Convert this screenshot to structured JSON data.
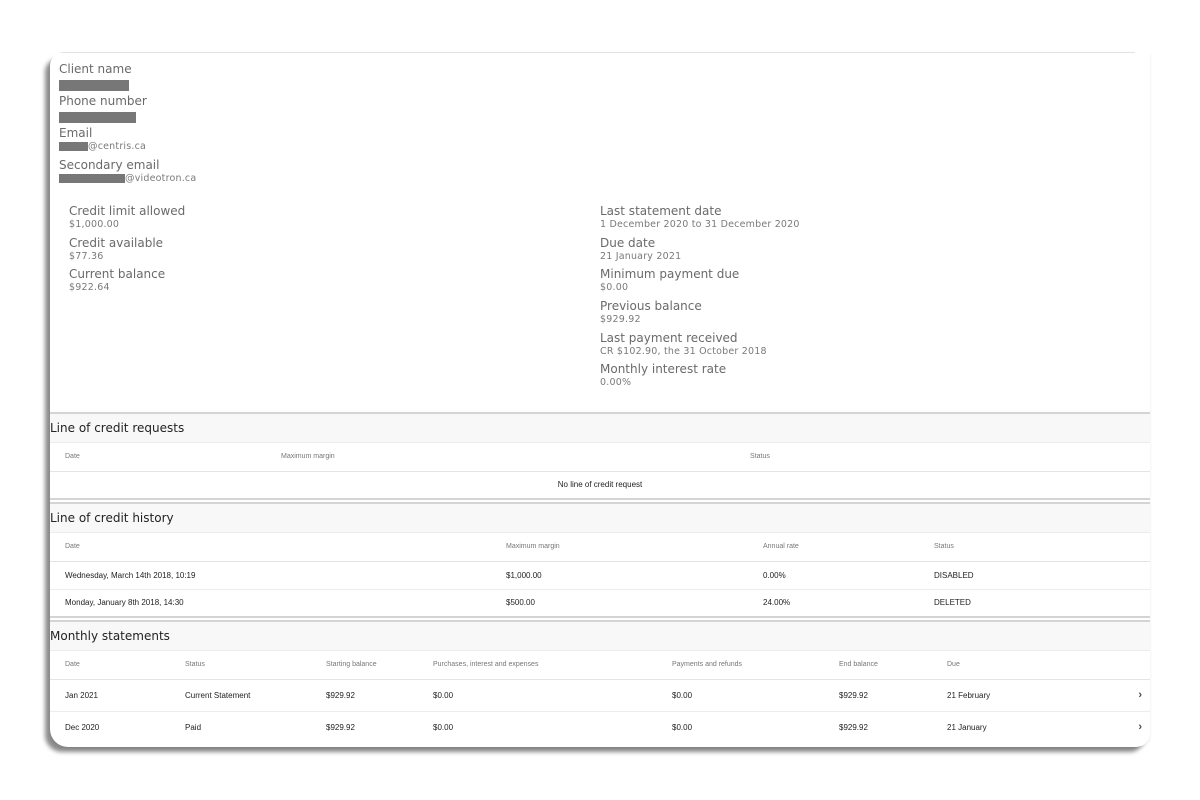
{
  "contact": {
    "client_name_label": "Client name",
    "phone_label": "Phone number",
    "email_label": "Email",
    "email_domain": "@centris.ca",
    "secondary_email_label": "Secondary email",
    "secondary_email_domain": "@videotron.ca"
  },
  "credit": {
    "left": [
      {
        "label": "Credit limit allowed",
        "value": "$1,000.00"
      },
      {
        "label": "Credit available",
        "value": "$77.36"
      },
      {
        "label": "Current balance",
        "value": "$922.64"
      }
    ],
    "right": [
      {
        "label": "Last statement date",
        "value": "1 December 2020 to 31 December 2020"
      },
      {
        "label": "Due date",
        "value": "21 January 2021"
      },
      {
        "label": "Minimum payment due",
        "value": "$0.00"
      },
      {
        "label": "Previous balance",
        "value": "$929.92"
      },
      {
        "label": "Last payment received",
        "value": "CR $102.90, the 31 October 2018"
      },
      {
        "label": "Monthly interest rate",
        "value": "0.00%"
      }
    ]
  },
  "requests": {
    "title": "Line of credit requests",
    "columns": [
      "Date",
      "Maximum margin",
      "Status"
    ],
    "empty_message": "No line of credit request"
  },
  "history": {
    "title": "Line of credit history",
    "columns": [
      "Date",
      "Maximum margin",
      "Annual rate",
      "Status"
    ],
    "rows": [
      [
        "Wednesday, March 14th 2018, 10:19",
        "$1,000.00",
        "0.00%",
        "DISABLED"
      ],
      [
        "Monday, January 8th 2018, 14:30",
        "$500.00",
        "24.00%",
        "DELETED"
      ]
    ]
  },
  "statements": {
    "title": "Monthly statements",
    "columns": [
      "Date",
      "Status",
      "Starting balance",
      "Purchases, interest and expenses",
      "Payments and refunds",
      "End balance",
      "Due"
    ],
    "rows": [
      [
        "Jan 2021",
        "Current Statement",
        "$929.92",
        "$0.00",
        "$0.00",
        "$929.92",
        "21 February"
      ],
      [
        "Dec 2020",
        "Paid",
        "$929.92",
        "$0.00",
        "$0.00",
        "$929.92",
        "21 January"
      ]
    ],
    "row_action_icon": "chevron-right-icon"
  }
}
